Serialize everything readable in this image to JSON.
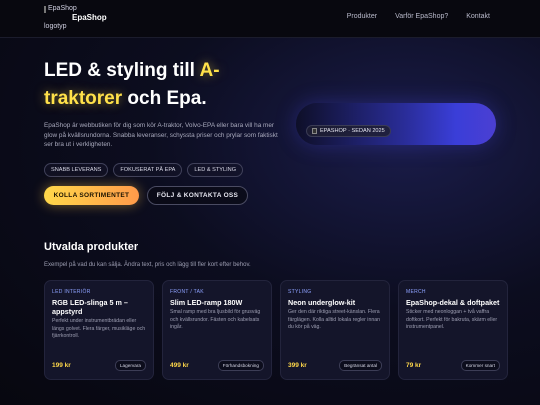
{
  "header": {
    "logo_alt_line1": "EpaShop",
    "logo_alt_line2": "logotyp",
    "brand": "EpaShop",
    "nav": [
      "Produkter",
      "Varför EpaShop?",
      "Kontakt"
    ]
  },
  "hero": {
    "title_part1": "LED & styling till ",
    "title_highlight": "A-traktorer",
    "title_part2": " och Epa.",
    "description": "EpaShop är webbutiken för dig som kör A-traktor, Volvo-EPA eller bara vill ha mer glow på kvällsrundorna. Snabba leveranser, schyssta priser och prylar som faktiskt ser bra ut i verkligheten.",
    "tags": [
      "SNABB LEVERANS",
      "FOKUSERAT PÅ EPA",
      "LED & STYLING"
    ],
    "primary_button": "KOLLA SORTIMENTET",
    "secondary_button": "FÖLJ & KONTAKTA OSS",
    "badge": "EPASHOP · SEDAN 2025"
  },
  "products": {
    "title": "Utvalda produkter",
    "subtitle": "Exempel på vad du kan sälja. Ändra text, pris och lägg till fler kort efter behov.",
    "items": [
      {
        "category": "LED INTERIÖR",
        "title": "RGB LED-slinga 5 m – appstyrd",
        "description": "Perfekt under instrumentbrädan eller längs golvet. Flera färger, musikläge och fjärrkontroll.",
        "price": "199 kr",
        "chip": "Lagervara"
      },
      {
        "category": "FRONT / TAK",
        "title": "Slim LED-ramp 180W",
        "description": "Smal ramp med bra ljusbild för grusväg och kvällsrundor. Fästen och kabelsats ingår.",
        "price": "499 kr",
        "chip": "Förhandsbokning"
      },
      {
        "category": "STYLING",
        "title": "Neon underglow-kit",
        "description": "Ger den där riktiga street-känslan. Flera färglägen. Kolla alltid lokala regler innan du kör på väg.",
        "price": "399 kr",
        "chip": "Begränsat antal"
      },
      {
        "category": "MERCH",
        "title": "EpaShop-dekal & doftpaket",
        "description": "Sticker med neonloggan + två vaffra doftkort. Perfekt för bakruta, skärm eller instrumentpanel.",
        "price": "79 kr",
        "chip": "Kommer snart"
      }
    ]
  },
  "colors": {
    "accent_yellow": "#ffe14a",
    "accent_orange": "#ff9a4a",
    "category_blue": "#8ea2ff",
    "background": "#07070f"
  }
}
